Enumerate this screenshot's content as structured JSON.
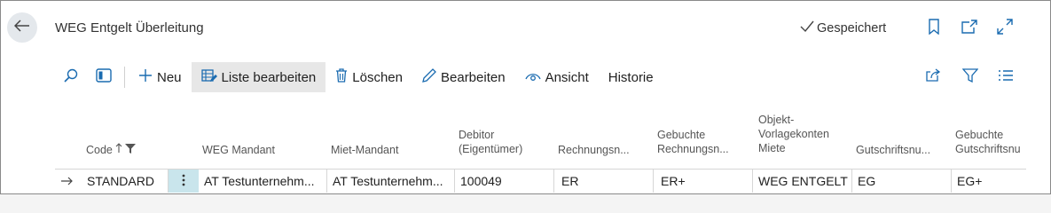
{
  "header": {
    "title": "WEG Entgelt Überleitung",
    "saved_label": "Gespeichert"
  },
  "icons": {
    "back": "back-arrow-icon",
    "bookmark": "bookmark-icon",
    "open_new": "open-in-new-window-icon",
    "expand": "expand-icon"
  },
  "toolbar": {
    "new_label": "Neu",
    "edit_list_label": "Liste bearbeiten",
    "delete_label": "Löschen",
    "edit_label": "Bearbeiten",
    "view_label": "Ansicht",
    "history_label": "Historie"
  },
  "columns": {
    "code": "Code",
    "weg_mandant": "WEG Mandant",
    "miet_mandant": "Miet-Mandant",
    "debitor_line1": "Debitor",
    "debitor_line2": "(Eigentümer)",
    "rechnungs": "Rechnungsn...",
    "gebuchte_rech_line1": "Gebuchte",
    "gebuchte_rech_line2": "Rechnungsn...",
    "objekt_line1": "Objekt-",
    "objekt_line2": "Vorlagekonten",
    "objekt_line3": "Miete",
    "gutschrift": "Gutschriftsnu...",
    "gebuchte_gut_line1": "Gebuchte",
    "gebuchte_gut_line2": "Gutschriftsnu"
  },
  "rows": [
    {
      "code": "STANDARD",
      "weg_mandant": "AT Testunternehm...",
      "miet_mandant": "AT Testunternehm...",
      "debitor": "100049",
      "rechnungs": "ER",
      "gebuchte_rech": "ER+",
      "objekt": "WEG ENTGELT",
      "gutschrift": "EG",
      "gebuchte_gut": "EG+"
    }
  ],
  "colors": {
    "accent": "#1a6bb0",
    "selected_cell": "#c9e5ec",
    "active_button": "#e7e7e7",
    "back_button": "#e4e8ec"
  }
}
